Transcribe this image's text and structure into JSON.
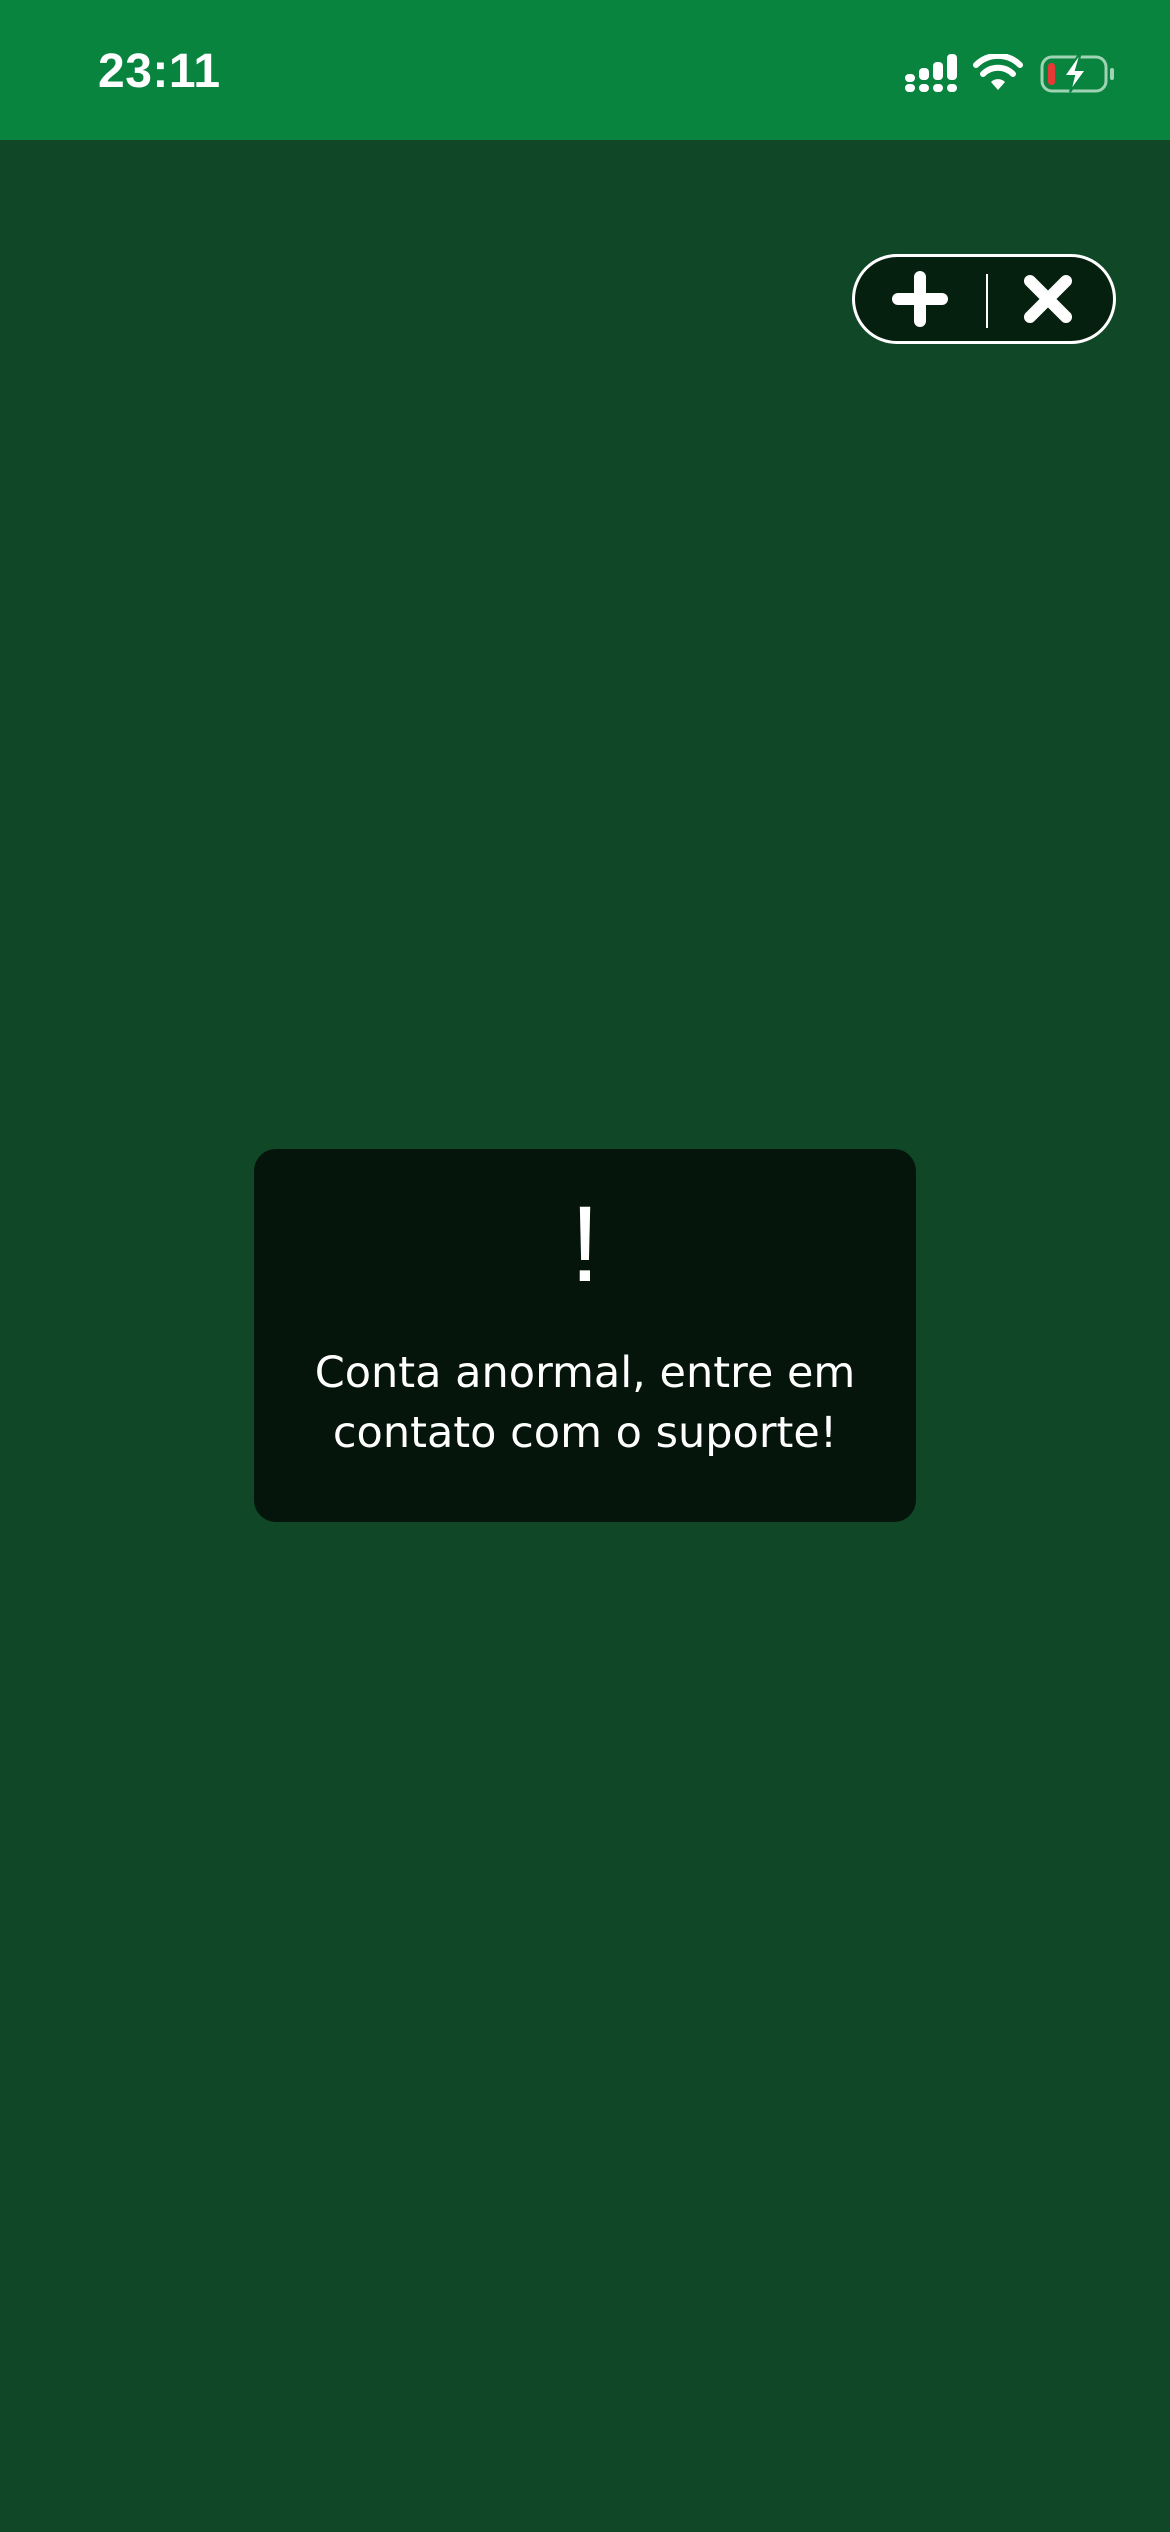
{
  "status_bar": {
    "time": "23:11",
    "icons": [
      "signal-icon",
      "wifi-icon",
      "battery-charging-icon"
    ],
    "background": "#08843f",
    "battery_level_color": "#e53935"
  },
  "mini_program_capsule": {
    "buttons": [
      "add-icon",
      "close-icon"
    ]
  },
  "toast": {
    "icon": "!",
    "message": "Conta anormal, entre em contato com o suporte!"
  },
  "colors": {
    "page_background": "#0f4727",
    "toast_background": "#06150c",
    "capsule_background": "#06200f",
    "text": "#ffffff"
  }
}
